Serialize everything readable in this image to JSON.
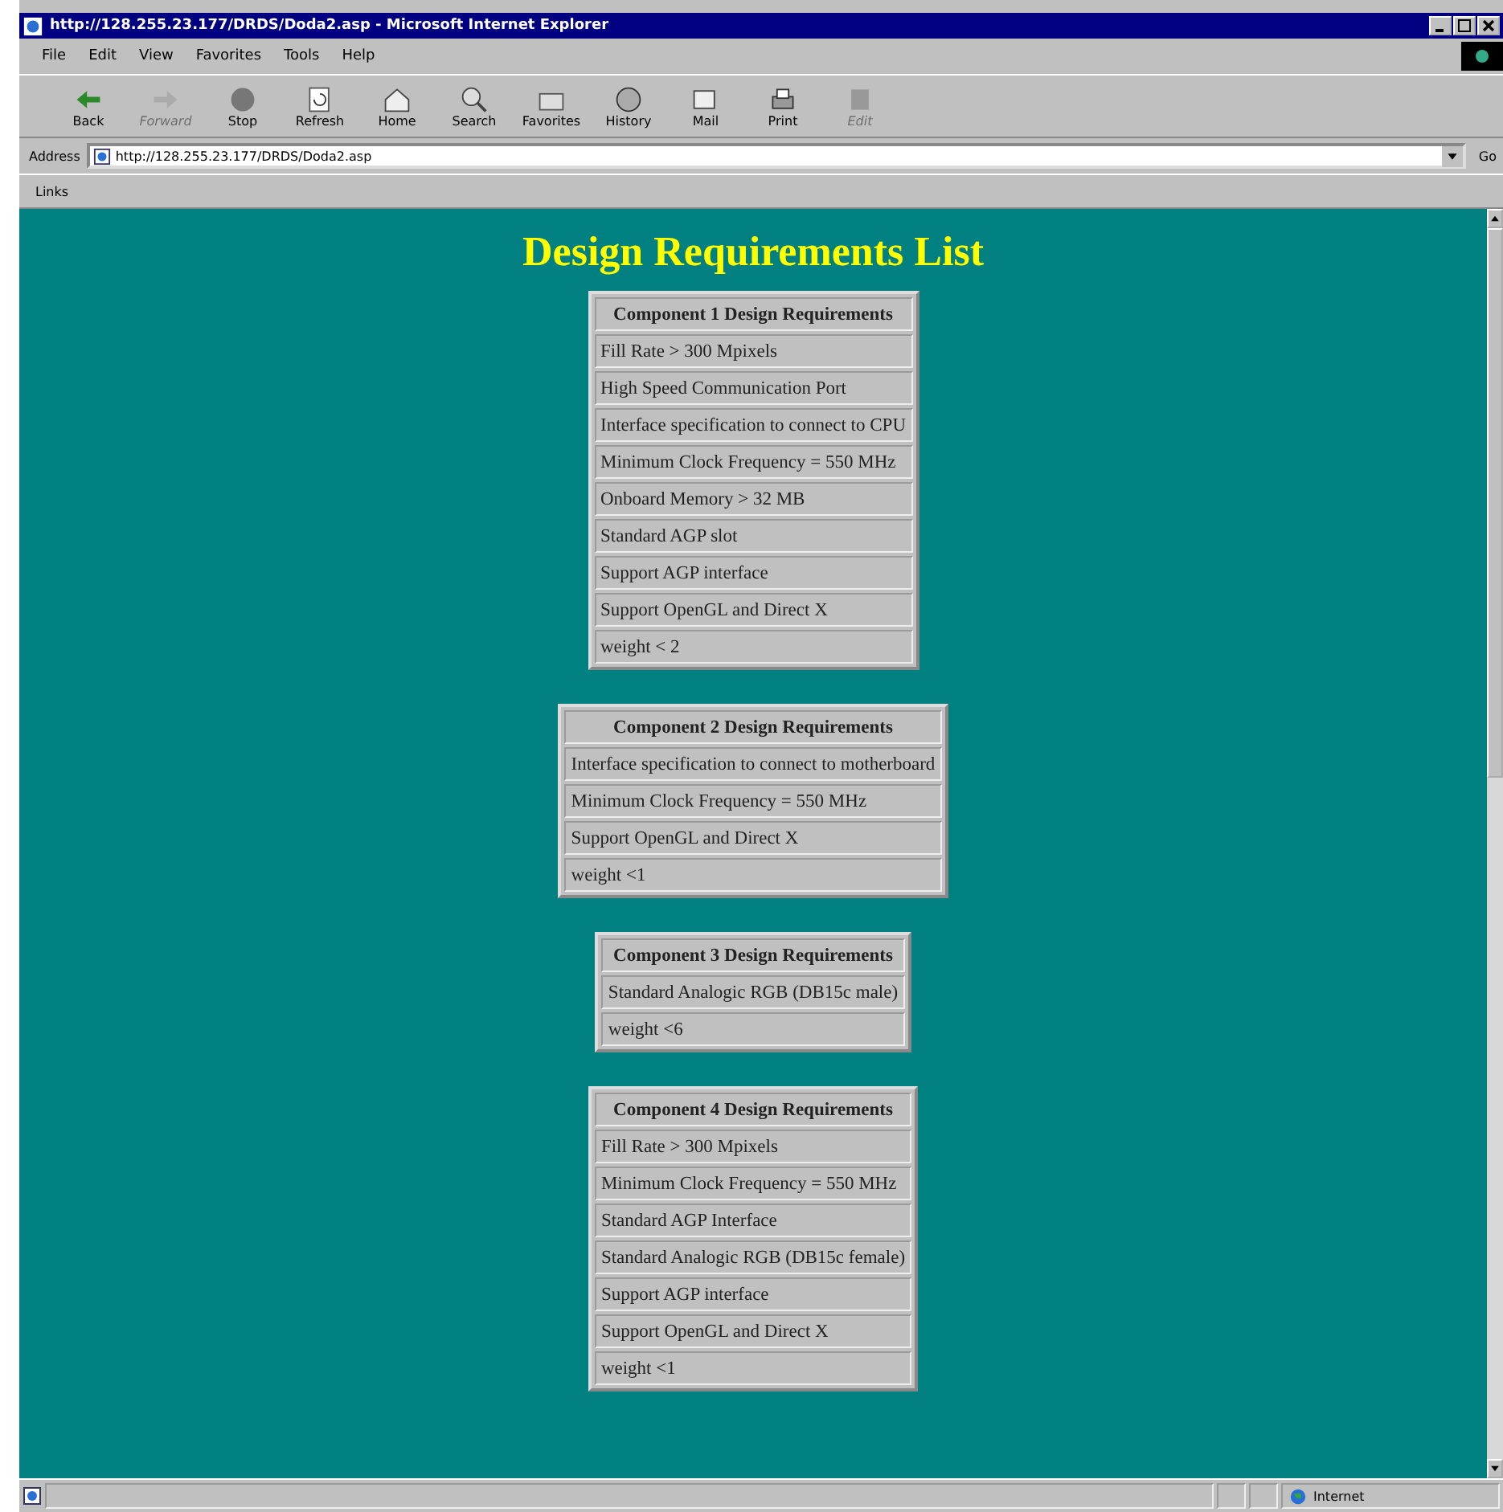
{
  "window": {
    "title": "http://128.255.23.177/DRDS/Doda2.asp - Microsoft Internet Explorer"
  },
  "menu": [
    "File",
    "Edit",
    "View",
    "Favorites",
    "Tools",
    "Help"
  ],
  "toolbar": [
    {
      "kind": "back",
      "label": "Back",
      "disabled": false
    },
    {
      "kind": "forward",
      "label": "Forward",
      "disabled": true
    },
    {
      "kind": "stop",
      "label": "Stop",
      "disabled": false
    },
    {
      "kind": "refresh",
      "label": "Refresh",
      "disabled": false
    },
    {
      "kind": "home",
      "label": "Home",
      "disabled": false
    },
    {
      "kind": "search",
      "label": "Search",
      "disabled": false
    },
    {
      "kind": "favorites",
      "label": "Favorites",
      "disabled": false
    },
    {
      "kind": "history",
      "label": "History",
      "disabled": false
    },
    {
      "kind": "mail",
      "label": "Mail",
      "disabled": false
    },
    {
      "kind": "print",
      "label": "Print",
      "disabled": false
    },
    {
      "kind": "edit",
      "label": "Edit",
      "disabled": true
    }
  ],
  "address": {
    "label": "Address",
    "value": "http://128.255.23.177/DRDS/Doda2.asp",
    "go": "Go"
  },
  "links": "Links",
  "page": {
    "title": "Design Requirements List",
    "tables": [
      {
        "heading": "Component 1 Design Requirements",
        "rows": [
          "Fill Rate > 300 Mpixels",
          "High Speed Communication Port",
          "Interface specification to connect to CPU",
          "Minimum Clock Frequency = 550 MHz",
          "Onboard Memory > 32 MB",
          "Standard AGP slot",
          "Support AGP interface",
          "Support OpenGL and Direct X",
          "weight < 2"
        ]
      },
      {
        "heading": "Component 2 Design Requirements",
        "rows": [
          "Interface specification to connect to motherboard",
          "Minimum Clock Frequency = 550 MHz",
          "Support OpenGL and Direct X",
          "weight <1"
        ]
      },
      {
        "heading": "Component 3 Design Requirements",
        "rows": [
          "Standard Analogic RGB (DB15c male)",
          "weight <6"
        ]
      },
      {
        "heading": "Component 4 Design Requirements",
        "rows": [
          "Fill Rate > 300 Mpixels",
          "Minimum Clock Frequency = 550 MHz",
          "Standard AGP Interface",
          "Standard Analogic RGB (DB15c female)",
          "Support AGP interface",
          "Support OpenGL and Direct X",
          "weight <1"
        ]
      }
    ]
  },
  "status_bar": {
    "zone": "Internet"
  }
}
